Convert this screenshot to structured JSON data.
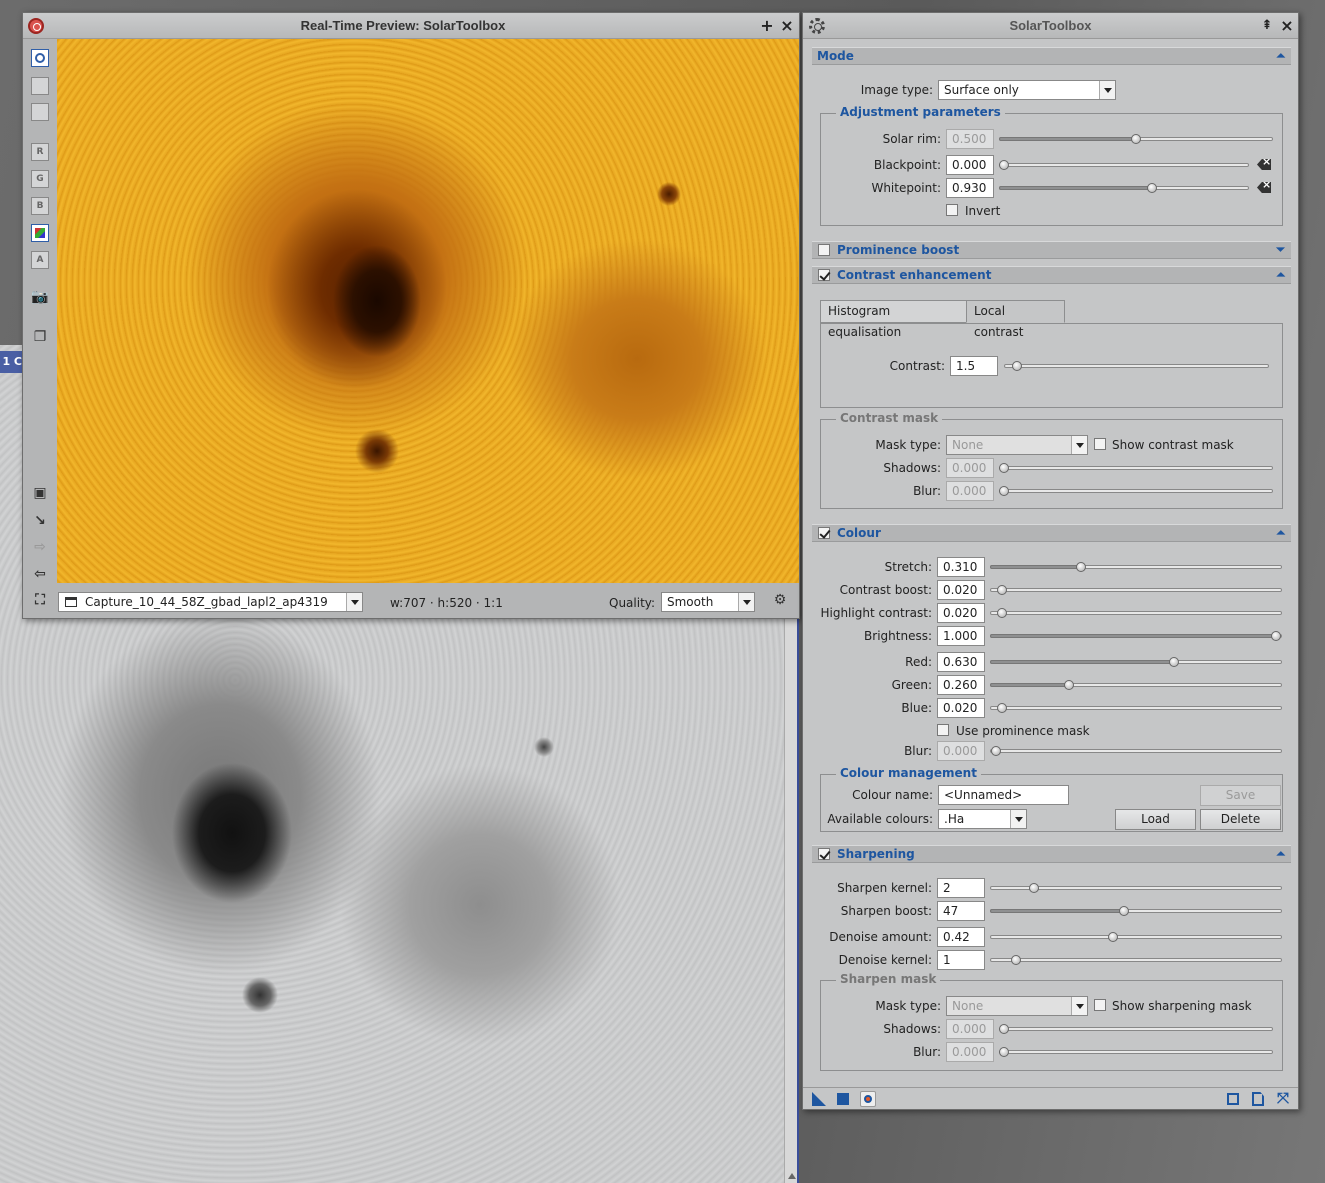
{
  "background_window": {
    "tab_label": "1 C"
  },
  "preview": {
    "title": "Real-Time Preview: SolarToolbox",
    "toolbar": [
      {
        "name": "readout-mode-tool",
        "glyph": "○"
      },
      {
        "name": "zoom-tool",
        "glyph": "▦"
      },
      {
        "name": "pan-tool",
        "glyph": "⧉"
      },
      {
        "name": "channel-r",
        "glyph": "R"
      },
      {
        "name": "channel-g",
        "glyph": "G"
      },
      {
        "name": "channel-b",
        "glyph": "B"
      },
      {
        "name": "channel-rgb",
        "glyph": "▣"
      },
      {
        "name": "channel-a",
        "glyph": "A"
      }
    ],
    "image_selector": "Capture_10_44_58Z_gbad_lapl2_ap4319",
    "image_info": "w:707 · h:520 · 1:1",
    "quality_label": "Quality:",
    "quality_value": "Smooth"
  },
  "toolbox": {
    "title": "SolarToolbox",
    "mode": {
      "header": "Mode",
      "image_type_label": "Image type:",
      "image_type_value": "Surface only",
      "adjustment": {
        "title": "Adjustment parameters",
        "solar_rim_label": "Solar rim:",
        "solar_rim_value": "0.500",
        "solar_rim_frac": 0.5,
        "blackpoint_label": "Blackpoint:",
        "blackpoint_value": "0.000",
        "blackpoint_frac": 0.0,
        "whitepoint_label": "Whitepoint:",
        "whitepoint_value": "0.930",
        "whitepoint_frac": 0.61,
        "invert_label": "Invert"
      }
    },
    "prominence": {
      "header": "Prominence boost",
      "checked": false
    },
    "contrast": {
      "header": "Contrast enhancement",
      "checked": true,
      "tabs": [
        "Histogram equalisation",
        "Local contrast"
      ],
      "contrast_label": "Contrast:",
      "contrast_value": "1.5",
      "mask": {
        "title": "Contrast mask",
        "mask_type_label": "Mask type:",
        "mask_type_value": "None",
        "show_label": "Show contrast mask",
        "shadows_label": "Shadows:",
        "shadows_value": "0.000",
        "blur_label": "Blur:",
        "blur_value": "0.000"
      }
    },
    "colour": {
      "header": "Colour",
      "checked": true,
      "stretch_label": "Stretch:",
      "stretch_value": "0.310",
      "contrast_boost_label": "Contrast boost:",
      "contrast_boost_value": "0.020",
      "highlight_label": "Highlight contrast:",
      "highlight_value": "0.020",
      "brightness_label": "Brightness:",
      "brightness_value": "1.000",
      "red_label": "Red:",
      "red_value": "0.630",
      "green_label": "Green:",
      "green_value": "0.260",
      "blue_label": "Blue:",
      "blue_value": "0.020",
      "use_prom_label": "Use prominence mask",
      "blur_label": "Blur:",
      "blur_value": "0.000",
      "management": {
        "title": "Colour management",
        "name_label": "Colour name:",
        "name_value": "<Unnamed>",
        "save_label": "Save",
        "available_label": "Available colours:",
        "available_value": ".Ha",
        "load_label": "Load",
        "delete_label": "Delete"
      }
    },
    "sharpening": {
      "header": "Sharpening",
      "checked": true,
      "kernel_label": "Sharpen kernel:",
      "kernel_value": "2",
      "boost_label": "Sharpen boost:",
      "boost_value": "47",
      "denoise_amount_label": "Denoise amount:",
      "denoise_amount_value": "0.42",
      "denoise_kernel_label": "Denoise kernel:",
      "denoise_kernel_value": "1",
      "mask": {
        "title": "Sharpen mask",
        "mask_type_label": "Mask type:",
        "mask_type_value": "None",
        "show_label": "Show sharpening mask",
        "shadows_label": "Shadows:",
        "shadows_value": "0.000",
        "blur_label": "Blur:",
        "blur_value": "0.000"
      }
    }
  },
  "colors": {
    "accent": "#1e56a0",
    "panel": "#c5c6c7",
    "header": "#b3b4b5"
  }
}
